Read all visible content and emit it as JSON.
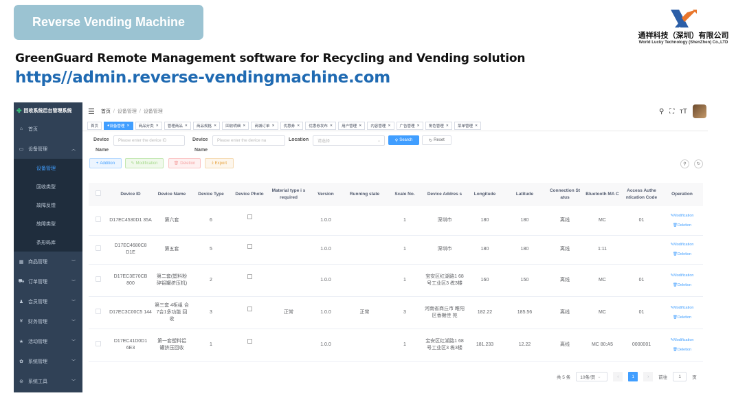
{
  "slide": {
    "title": "Reverse Vending Machine",
    "headline": "GreenGuard Remote Management software for Recycling and Vending solution",
    "url": "https//admin.reverse-vendingmachine.com"
  },
  "logo": {
    "cn": "通祥科技（深圳）有限公司",
    "en": "World Lucky Technology (ShenZhen) Co.,LTD"
  },
  "sidebar": {
    "app_title": "回收系统后台管理系统",
    "items": [
      {
        "label": "首页",
        "icon": "home-icon"
      },
      {
        "label": "设备管理",
        "icon": "monitor-icon"
      },
      {
        "label": "商品管理",
        "icon": "grid-icon"
      },
      {
        "label": "订单管理",
        "icon": "cart-icon"
      },
      {
        "label": "会员管理",
        "icon": "user-icon"
      },
      {
        "label": "财务管理",
        "icon": "yen-icon"
      },
      {
        "label": "活动管理",
        "icon": "star-icon"
      },
      {
        "label": "系统管理",
        "icon": "gear-icon"
      },
      {
        "label": "系统工具",
        "icon": "tool-icon"
      }
    ],
    "sub_items": [
      "设备管理",
      "回收类型",
      "故障反馈",
      "故障类型",
      "条形码库"
    ]
  },
  "breadcrumb": [
    "首页",
    "设备管理",
    "设备管理"
  ],
  "tags": [
    "首页",
    "设备管理",
    "商品分类",
    "管理商品",
    "商品规格",
    "回收明细",
    "商城订单",
    "优惠券",
    "优惠券发布",
    "用户管理",
    "内容管理",
    "广告管理",
    "角色管理",
    "菜单管理"
  ],
  "filters": {
    "device_label": "Device",
    "name_label": "Name",
    "device_id_placeholder": "Please enter the device ID",
    "device_name_placeholder": "Please enter the device na",
    "location_label": "Location",
    "location_placeholder": "请选择",
    "search_label": "Search",
    "reset_label": "Reset"
  },
  "actions": {
    "add": "Addition",
    "modify": "Modification",
    "delete": "Deletion",
    "export": "Export"
  },
  "table": {
    "headers": [
      "Device ID",
      "Device Name",
      "Device Type",
      "Device Photo",
      "Material type i s required",
      "Version",
      "Running state",
      "Scale No.",
      "Device Addres s",
      "Longitude",
      "Latitude",
      "Connection St atus",
      "Bluetooth MA C",
      "Access Authe ntication Code",
      "Operation"
    ],
    "rows": [
      {
        "id": "D17EC4530D1 35A",
        "name": "第六套",
        "type": "6",
        "material": "",
        "version": "1.0.0",
        "running": "",
        "scale": "1",
        "address": "深圳市",
        "lng": "180",
        "lat": "180",
        "conn": "离线",
        "mac": "MC",
        "code": "01"
      },
      {
        "id": "D17EC4680C8 D1E",
        "name": "第五套",
        "type": "5",
        "material": "",
        "version": "1.0.0",
        "running": "",
        "scale": "1",
        "address": "深圳市",
        "lng": "180",
        "lat": "180",
        "conn": "离线",
        "mac": "1:11",
        "code": ""
      },
      {
        "id": "D17EC3E70CB 800",
        "name": "第二套(塑料粉 碎铝罐挤压机)",
        "type": "2",
        "material": "",
        "version": "1.0.0",
        "running": "",
        "scale": "1",
        "address": "宝安区红湖路1 68号工业区3 栋3楼",
        "lng": "160",
        "lat": "150",
        "conn": "离线",
        "mac": "MC",
        "code": "01"
      },
      {
        "id": "D17EC3C00C5 144",
        "name": "第三套 4柜组 合 7合1多功能 回收",
        "type": "3",
        "material": "正常",
        "version": "1.0.0",
        "running": "正常",
        "scale": "3",
        "address": "河南省商丘市 睢阳区香榭佳 苑",
        "lng": "182.22",
        "lat": "185.56",
        "conn": "离线",
        "mac": "MC",
        "code": "01"
      },
      {
        "id": "D17EC41D0D1 6E3",
        "name": "第一套塑料铝 罐挤压回收",
        "type": "1",
        "material": "",
        "version": "1.0.0",
        "running": "",
        "scale": "1",
        "address": "宝安区红湖路1 68号工业区3 栋3楼",
        "lng": "181.233",
        "lat": "12.22",
        "conn": "离线",
        "mac": "MC 80:A5",
        "code": "0000001"
      }
    ],
    "op_modify": "Modification",
    "op_delete": "Deletion"
  },
  "pagination": {
    "total": "共 5 条",
    "page_size": "10条/页",
    "current": "1",
    "goto_label": "前往",
    "goto_value": "1",
    "page_unit": "页"
  }
}
